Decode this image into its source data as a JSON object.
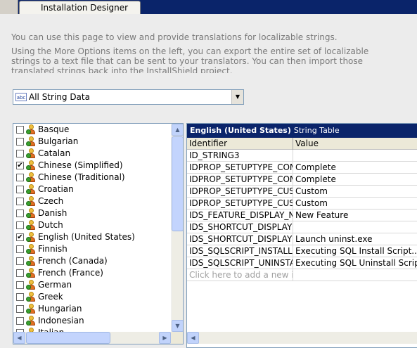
{
  "tab": {
    "title": "Installation Designer"
  },
  "description": {
    "line1": "You can use this page to view and provide translations for localizable strings.",
    "line2": "Using the More Options items on the left, you can export the entire set of localizable strings to a text file that can be sent to your translators. You can then import those translated strings back into the InstallShield project."
  },
  "filter": {
    "icon": "abc",
    "value": "All String Data"
  },
  "languages": [
    {
      "name": "Basque",
      "checked": false,
      "icon": "language-icon"
    },
    {
      "name": "Bulgarian",
      "checked": false,
      "icon": "language-icon"
    },
    {
      "name": "Catalan",
      "checked": false,
      "icon": "language-icon"
    },
    {
      "name": "Chinese (Simplified)",
      "checked": true,
      "icon": "language-icon"
    },
    {
      "name": "Chinese (Traditional)",
      "checked": false,
      "icon": "language-icon"
    },
    {
      "name": "Croatian",
      "checked": false,
      "icon": "language-icon"
    },
    {
      "name": "Czech",
      "checked": false,
      "icon": "language-icon"
    },
    {
      "name": "Danish",
      "checked": false,
      "icon": "language-icon"
    },
    {
      "name": "Dutch",
      "checked": false,
      "icon": "language-icon"
    },
    {
      "name": "English (United States)",
      "checked": true,
      "icon": "language-icon"
    },
    {
      "name": "Finnish",
      "checked": false,
      "icon": "language-icon"
    },
    {
      "name": "French (Canada)",
      "checked": false,
      "icon": "language-icon"
    },
    {
      "name": "French (France)",
      "checked": false,
      "icon": "language-icon"
    },
    {
      "name": "German",
      "checked": false,
      "icon": "language-icon"
    },
    {
      "name": "Greek",
      "checked": false,
      "icon": "language-icon"
    },
    {
      "name": "Hungarian",
      "checked": false,
      "icon": "language-icon"
    },
    {
      "name": "Indonesian",
      "checked": false,
      "icon": "language-icon"
    },
    {
      "name": "Italian",
      "checked": false,
      "icon": "language-icon"
    }
  ],
  "grid": {
    "title": "English (United States)",
    "subtitle": "String Table",
    "columns": [
      "Identifier",
      "Value"
    ],
    "rows": [
      {
        "id": "ID_STRING3",
        "value": ""
      },
      {
        "id": "IDPROP_SETUPTYPE_COM",
        "value": "Complete"
      },
      {
        "id": "IDPROP_SETUPTYPE_COM",
        "value": "Complete"
      },
      {
        "id": "IDPROP_SETUPTYPE_CUS",
        "value": "Custom"
      },
      {
        "id": "IDPROP_SETUPTYPE_CUS",
        "value": "Custom"
      },
      {
        "id": "IDS_FEATURE_DISPLAY_N",
        "value": "New Feature"
      },
      {
        "id": "IDS_SHORTCUT_DISPLAY",
        "value": ""
      },
      {
        "id": "IDS_SHORTCUT_DISPLAY",
        "value": "Launch uninst.exe"
      },
      {
        "id": "IDS_SQLSCRIPT_INSTALLI",
        "value": "Executing SQL Install Script..."
      },
      {
        "id": "IDS_SQLSCRIPT_UNINSTA",
        "value": "Executing SQL Uninstall Script..."
      }
    ],
    "new_row_placeholder": "Click here to add a new ite"
  }
}
